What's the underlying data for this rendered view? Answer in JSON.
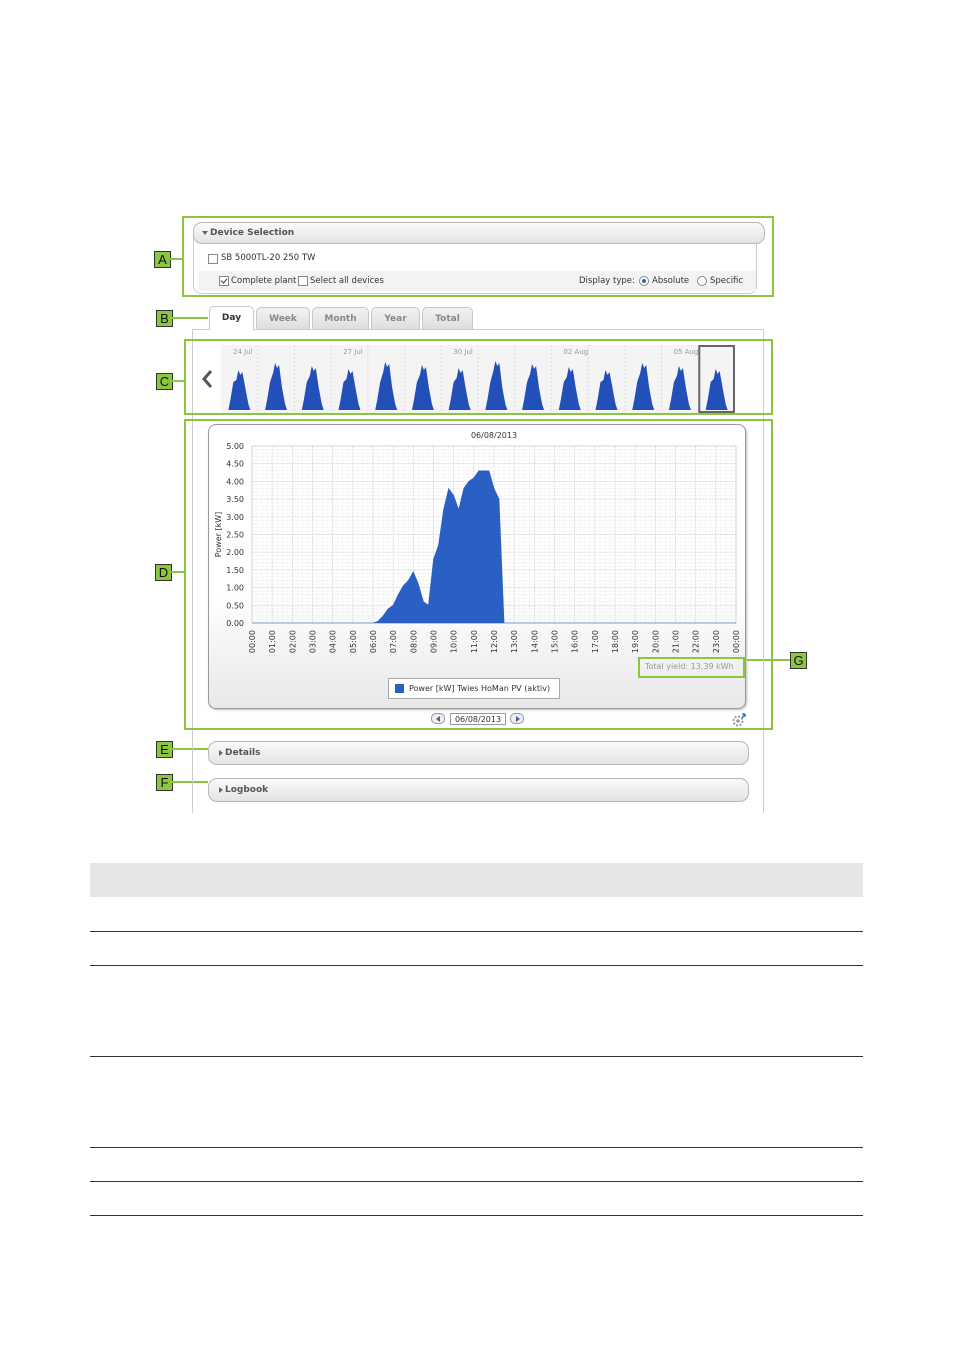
{
  "device_selection": {
    "header": "Device Selection",
    "device_name": "SB 5000TL-20 250 TW",
    "complete_plant_label": "Complete plant",
    "complete_plant_checked": true,
    "select_all_label": "Select all devices",
    "select_all_checked": false,
    "display_type_label": "Display type:",
    "display_options": [
      "Absolute",
      "Specific"
    ],
    "display_selected": "Absolute"
  },
  "tabs": [
    {
      "label": "Day",
      "active": true
    },
    {
      "label": "Week",
      "active": false
    },
    {
      "label": "Month",
      "active": false
    },
    {
      "label": "Year",
      "active": false
    },
    {
      "label": "Total",
      "active": false
    }
  ],
  "thumbnail_strip": {
    "date_labels": [
      "24 Jul",
      "27 Jul",
      "30 Jul",
      "02 Aug",
      "05 Aug"
    ],
    "day_count": 14,
    "selected_index": 13
  },
  "chart_data": {
    "type": "area",
    "title": "06/08/2013",
    "ylabel": "Power [kW]",
    "ylim": [
      0,
      5
    ],
    "yticks": [
      "0.00",
      "0.50",
      "1.00",
      "1.50",
      "2.00",
      "2.50",
      "3.00",
      "3.50",
      "4.00",
      "4.50",
      "5.00"
    ],
    "xticks": [
      "00:00",
      "01:00",
      "02:00",
      "03:00",
      "04:00",
      "05:00",
      "06:00",
      "07:00",
      "08:00",
      "09:00",
      "10:00",
      "11:00",
      "12:00",
      "13:00",
      "14:00",
      "15:00",
      "16:00",
      "17:00",
      "18:00",
      "19:00",
      "20:00",
      "21:00",
      "22:00",
      "23:00",
      "00:00"
    ],
    "series": [
      {
        "name": "Power [kW] Twies HoMan PV (aktiv)",
        "color": "#2a5fc4",
        "x": [
          "00:00",
          "06:00",
          "06:15",
          "06:30",
          "06:45",
          "07:00",
          "07:15",
          "07:30",
          "07:45",
          "08:00",
          "08:15",
          "08:30",
          "08:45",
          "09:00",
          "09:15",
          "09:30",
          "09:45",
          "10:00",
          "10:15",
          "10:30",
          "10:45",
          "11:00",
          "11:15",
          "11:30",
          "11:45",
          "12:00",
          "12:15",
          "12:30",
          "24:00"
        ],
        "values": [
          0,
          0,
          0.05,
          0.2,
          0.4,
          0.5,
          0.8,
          1.05,
          1.2,
          1.45,
          1.1,
          0.6,
          0.5,
          1.8,
          2.2,
          3.2,
          3.8,
          3.6,
          3.2,
          3.8,
          4.0,
          4.1,
          4.3,
          4.3,
          4.3,
          3.8,
          3.5,
          0,
          0
        ]
      }
    ],
    "legend_position": "bottom-center",
    "grid": true
  },
  "total_yield": "Total yield: 13,39 kWh",
  "date_nav": {
    "date": "06/08/2013"
  },
  "details_label": "Details",
  "logbook_label": "Logbook",
  "callouts": [
    "A",
    "B",
    "C",
    "D",
    "E",
    "F",
    "G"
  ]
}
